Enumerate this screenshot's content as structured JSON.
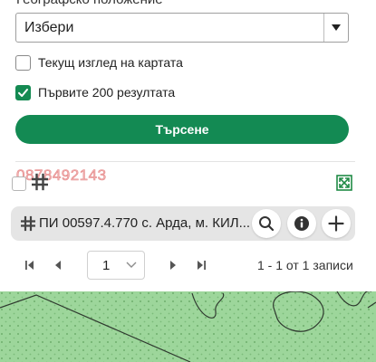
{
  "filters": {
    "location_label": "Географско положение",
    "location_select_value": "Избери",
    "current_view_label": "Текущ изглед на картата",
    "current_view_checked": false,
    "first200_label": "Първите 200 резултата",
    "first200_checked": true,
    "search_button_label": "Търсене"
  },
  "watermark": {
    "phone": "0878492143"
  },
  "results": [
    {
      "text": "ПИ 00597.4.770 с. Арда, м. КИЛ..."
    }
  ],
  "pagination": {
    "current_page": "1",
    "summary": "1 - 1 от 1 записи"
  },
  "colors": {
    "primary_green": "#138a53",
    "card_bg": "#e5e5e5",
    "map_green": "#9dd69b"
  },
  "icons": {
    "grid": "hash-grid-icon",
    "zoom_extent": "zoom-extent-icon",
    "search": "search-icon",
    "info": "info-icon",
    "add": "plus-icon"
  }
}
